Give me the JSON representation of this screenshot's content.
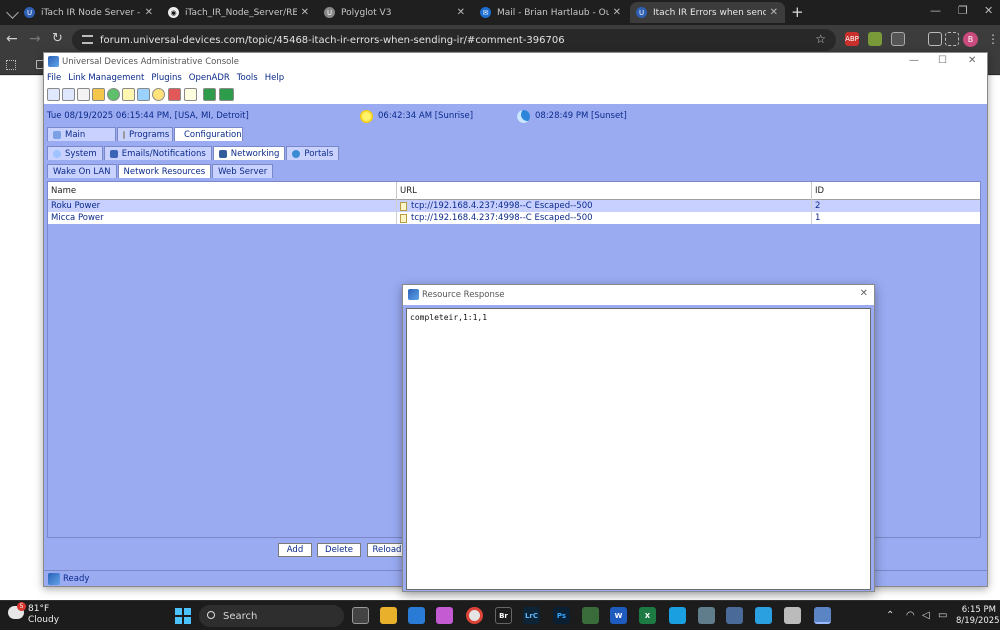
{
  "browser": {
    "tabs": [
      {
        "title": "iTach IR Node Server - Global C",
        "fav_color": "#2e5fb3",
        "fav_glyph": "U"
      },
      {
        "title": "iTach_IR_Node_Server/README",
        "fav_color": "#eeeeee",
        "fav_glyph": "◉"
      },
      {
        "title": "Polyglot V3",
        "fav_color": "#888888",
        "fav_glyph": "U"
      },
      {
        "title": "Mail - Brian Hartlaub - Outlook",
        "fav_color": "#1d6fd1",
        "fav_glyph": "✉"
      },
      {
        "title": "Itach IR Errors when sending IR",
        "fav_color": "#2e5fb3",
        "fav_glyph": "U"
      }
    ],
    "url": "forum.universal-devices.com/topic/45468-itach-ir-errors-when-sending-ir/#comment-396706",
    "profile_initial": "B",
    "extensions": [
      {
        "label": "ABP",
        "color": "#c9302c"
      },
      {
        "label": "",
        "color": "#7a9a3a"
      },
      {
        "label": "",
        "color": "#555555"
      }
    ]
  },
  "console": {
    "title": "Universal Devices Administrative Console",
    "menu": [
      "File",
      "Link Management",
      "Plugins",
      "OpenADR",
      "Tools",
      "Help"
    ],
    "datetime": "Tue 08/19/2025 06:15:44 PM,  [USA, MI, Detroit]",
    "sunrise": "06:42:34 AM [Sunrise]",
    "sunset": "08:28:49 PM [Sunset]",
    "main_tabs": [
      {
        "label": "Main",
        "selected": false
      },
      {
        "label": "Programs",
        "selected": false
      },
      {
        "label": "Configuration",
        "selected": true
      }
    ],
    "config_tabs": [
      {
        "label": "System",
        "selected": false
      },
      {
        "label": "Emails/Notifications",
        "selected": false
      },
      {
        "label": "Networking",
        "selected": true
      },
      {
        "label": "Portals",
        "selected": false
      }
    ],
    "network_tabs": [
      {
        "label": "Wake On LAN",
        "selected": false
      },
      {
        "label": "Network Resources",
        "selected": true
      },
      {
        "label": "Web Server",
        "selected": false
      }
    ],
    "table": {
      "headers": [
        "Name",
        "URL",
        "ID"
      ],
      "rows": [
        {
          "name": "Roku Power",
          "url": "tcp://192.168.4.237:4998--C Escaped--500",
          "id": "2"
        },
        {
          "name": "Micca Power",
          "url": "tcp://192.168.4.237:4998--C Escaped--500",
          "id": "1"
        }
      ]
    },
    "buttons": {
      "add": "Add",
      "delete": "Delete",
      "reload": "Reload"
    },
    "status": "Ready"
  },
  "dialog": {
    "title": "Resource Response",
    "response": "completeir,1:1,1"
  },
  "taskbar": {
    "weather_temp": "81°F",
    "weather_desc": "Cloudy",
    "weather_badge": "5",
    "search_label": "Search",
    "time": "6:15 PM",
    "date": "8/19/2025",
    "apps": [
      {
        "label": "",
        "color": "#444444"
      },
      {
        "label": "",
        "color": "#e8b02b"
      },
      {
        "label": "",
        "color": "#2a7bd5"
      },
      {
        "label": "",
        "color": "#c55bd3"
      },
      {
        "label": "",
        "color": "#e5e5e5"
      },
      {
        "label": "Br",
        "color": "#1c1c1c"
      },
      {
        "label": "LrC",
        "color": "#0c2436"
      },
      {
        "label": "Ps",
        "color": "#0b1f33"
      },
      {
        "label": "",
        "color": "#3a6b3a"
      },
      {
        "label": "W",
        "color": "#1e5bbf"
      },
      {
        "label": "X",
        "color": "#1d7a43"
      },
      {
        "label": "",
        "color": "#1aa0e0"
      },
      {
        "label": "",
        "color": "#607d8b"
      },
      {
        "label": "",
        "color": "#4a6a9a"
      },
      {
        "label": "",
        "color": "#2aa0e0"
      },
      {
        "label": "",
        "color": "#bbbbbb"
      },
      {
        "label": "",
        "color": "#5b84c4"
      }
    ]
  }
}
